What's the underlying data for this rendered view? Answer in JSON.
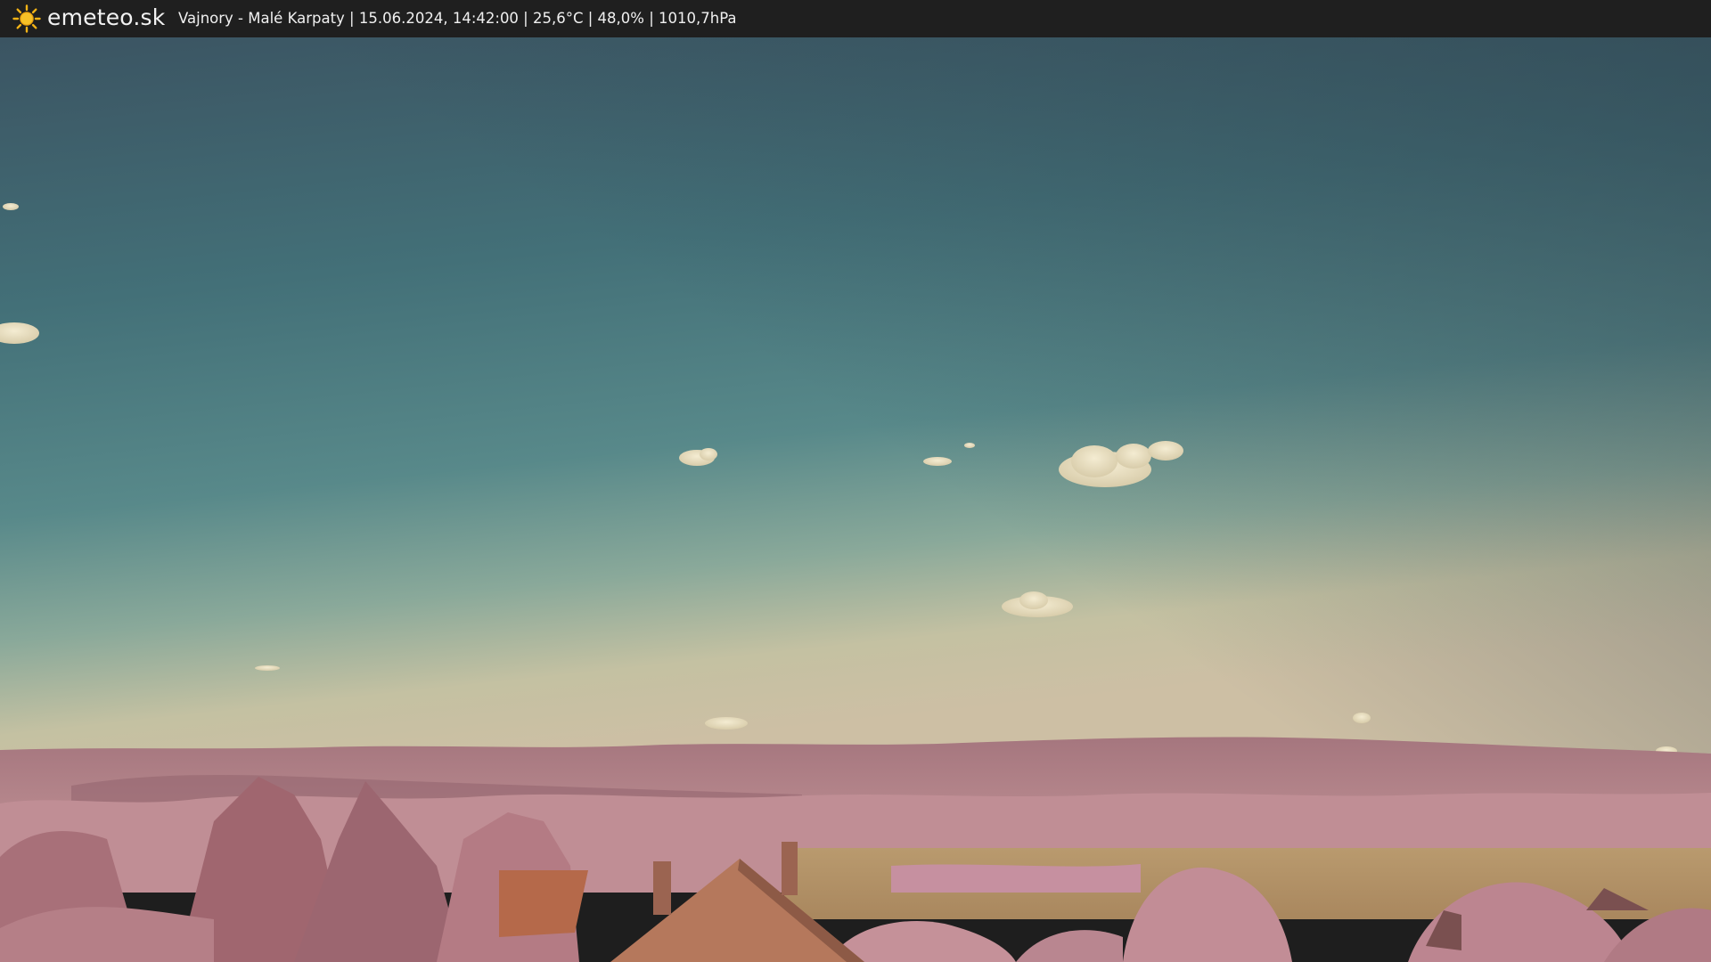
{
  "header": {
    "brand": "emeteo.sk",
    "caption": "Vajnory - Malé Karpaty | 15.06.2024, 14:42:00 | 25,6°C | 48,0% | 1010,7hPa",
    "logo_icon": "sun-icon"
  },
  "colors": {
    "bar_bg": "#1f1f1f",
    "sun": "#f3b316",
    "sky_top": "#3c505e",
    "sky_mid": "#4a7c80",
    "sky_horizon": "#c9c2a0",
    "hills": "#a77a82",
    "foliage": "#b88088",
    "field": "#b89668",
    "roof": "#b86e4c"
  }
}
